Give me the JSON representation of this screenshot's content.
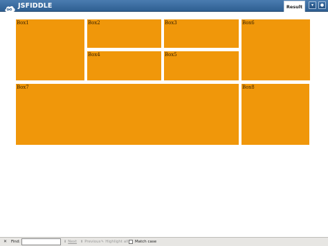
{
  "header": {
    "logo_text": "JSFIDDLE",
    "result_tab": "Result"
  },
  "colors": {
    "header": "#2f5f92",
    "box_fill": "#f0970a",
    "findbar_bg": "#e7e6e3"
  },
  "boxes": [
    {
      "label": "Box1"
    },
    {
      "label": "Box2"
    },
    {
      "label": "Box3"
    },
    {
      "label": "Box4"
    },
    {
      "label": "Box5"
    },
    {
      "label": "Box6"
    },
    {
      "label": "Box7"
    },
    {
      "label": "Box8"
    }
  ],
  "findbar": {
    "find_label": "Find:",
    "find_value": "",
    "next": "Next",
    "previous": "Previous",
    "highlight": "Highlight all",
    "match_case": "Match case",
    "icons": [
      "close-icon",
      "arrow-down-icon",
      "arrow-up-icon",
      "highlight-icon"
    ]
  }
}
